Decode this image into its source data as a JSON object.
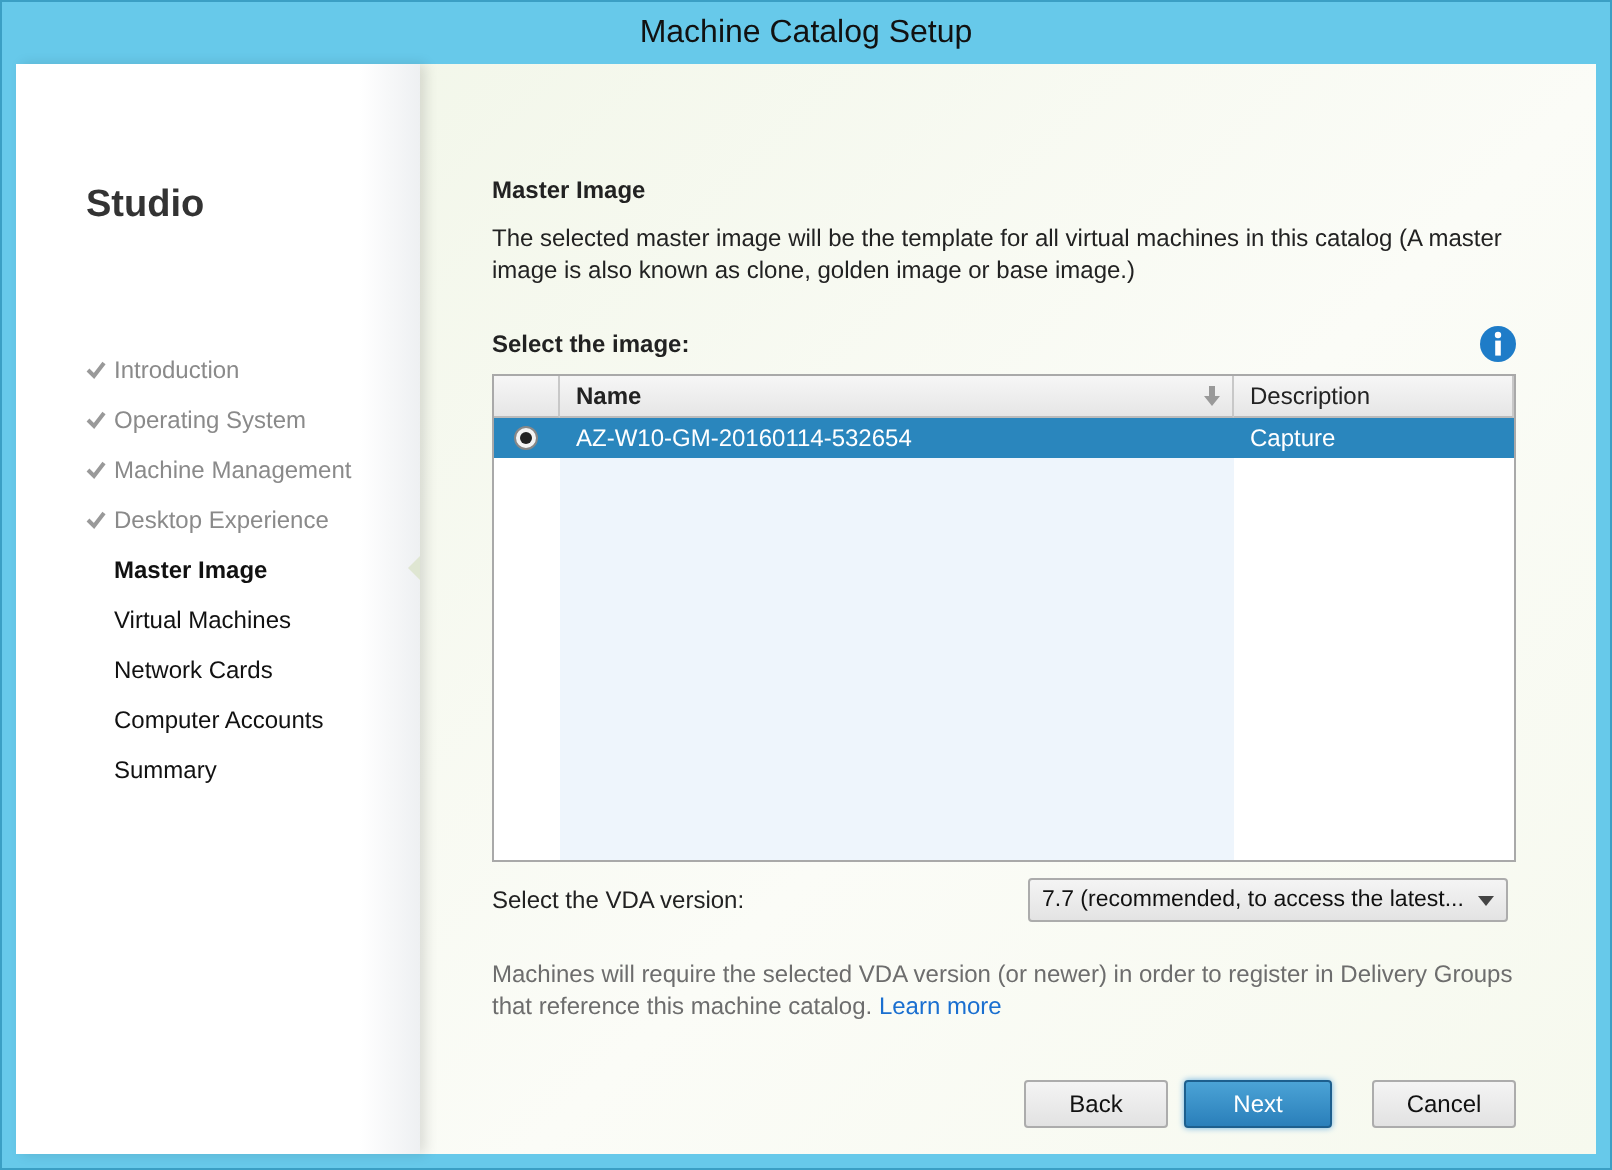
{
  "window": {
    "title": "Machine Catalog Setup"
  },
  "sidebar": {
    "title": "Studio",
    "steps": [
      {
        "label": "Introduction",
        "completed": true,
        "selected": false
      },
      {
        "label": "Operating System",
        "completed": true,
        "selected": false
      },
      {
        "label": "Machine Management",
        "completed": true,
        "selected": false
      },
      {
        "label": "Desktop Experience",
        "completed": true,
        "selected": false
      },
      {
        "label": "Master Image",
        "completed": false,
        "selected": true
      },
      {
        "label": "Virtual Machines",
        "completed": false,
        "selected": false
      },
      {
        "label": "Network Cards",
        "completed": false,
        "selected": false
      },
      {
        "label": "Computer Accounts",
        "completed": false,
        "selected": false
      },
      {
        "label": "Summary",
        "completed": false,
        "selected": false
      }
    ]
  },
  "page": {
    "heading": "Master Image",
    "description": "The selected master image will be the template for all virtual machines in this catalog (A master image is also known as clone, golden image or base image.)",
    "table_label": "Select the image:",
    "table": {
      "columns": [
        {
          "label": "Name",
          "sorted": true
        },
        {
          "label": "Description",
          "sorted": false
        }
      ],
      "rows": [
        {
          "name": "AZ-W10-GM-20160114-532654",
          "description": "Capture",
          "selected": true
        }
      ]
    },
    "vda_label": "Select the VDA version:",
    "vda_value": "7.7 (recommended, to access the latest...",
    "note": "Machines will require the selected VDA version (or newer) in order to register in Delivery Groups that reference this machine catalog.",
    "note_link": "Learn more"
  },
  "buttons": [
    {
      "label": "Back",
      "primary": false
    },
    {
      "label": "Next",
      "primary": true
    },
    {
      "label": "Cancel",
      "primary": false
    }
  ]
}
